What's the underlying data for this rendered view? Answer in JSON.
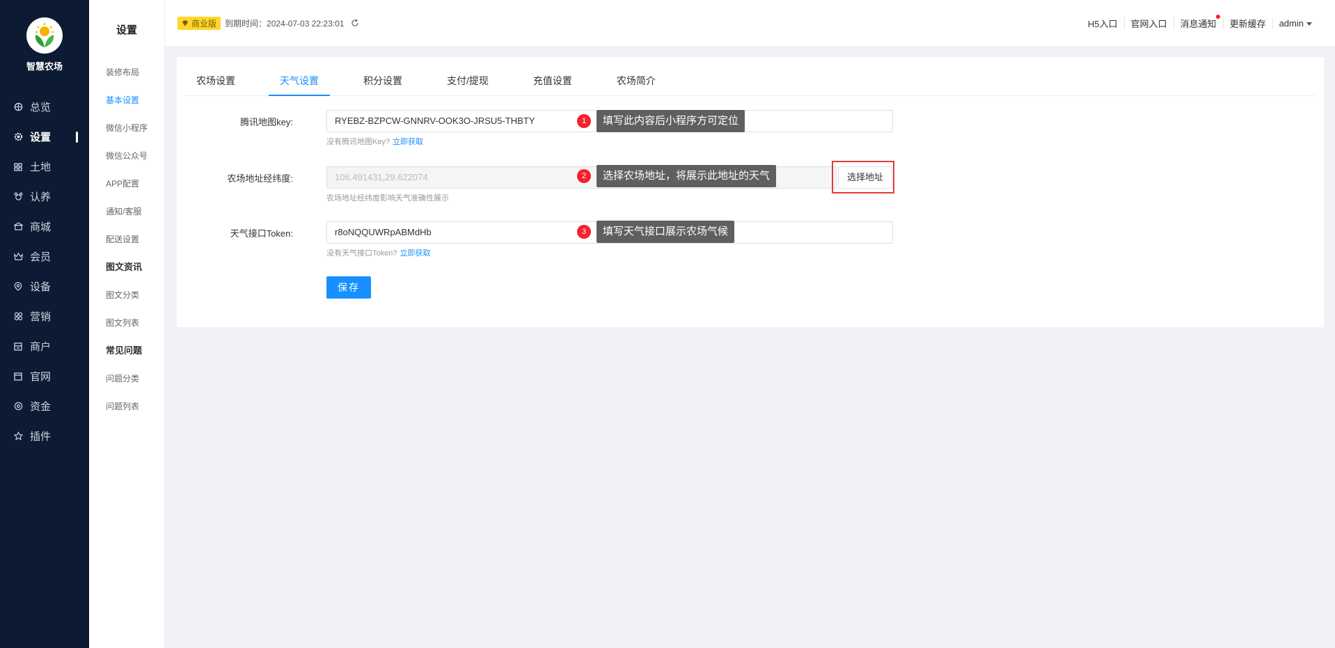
{
  "brand": {
    "name": "智慧农场"
  },
  "nav": [
    {
      "label": "总览",
      "icon": "dashboard-icon"
    },
    {
      "label": "设置",
      "icon": "gear-icon",
      "active": true
    },
    {
      "label": "土地",
      "icon": "grid-icon"
    },
    {
      "label": "认养",
      "icon": "adopt-icon"
    },
    {
      "label": "商城",
      "icon": "shop-icon"
    },
    {
      "label": "会员",
      "icon": "member-icon"
    },
    {
      "label": "设备",
      "icon": "device-icon"
    },
    {
      "label": "营销",
      "icon": "marketing-icon"
    },
    {
      "label": "商户",
      "icon": "merchant-icon"
    },
    {
      "label": "官网",
      "icon": "website-icon"
    },
    {
      "label": "资金",
      "icon": "fund-icon"
    },
    {
      "label": "插件",
      "icon": "star-icon"
    }
  ],
  "subnav": {
    "title": "设置",
    "items": [
      {
        "label": "装修布局"
      },
      {
        "label": "基本设置",
        "active": true
      },
      {
        "label": "微信小程序"
      },
      {
        "label": "微信公众号"
      },
      {
        "label": "APP配置"
      },
      {
        "label": "通知/客服"
      },
      {
        "label": "配送设置"
      }
    ],
    "groups": [
      {
        "title": "图文资讯",
        "items": [
          {
            "label": "图文分类"
          },
          {
            "label": "图文列表"
          }
        ]
      },
      {
        "title": "常见问题",
        "items": [
          {
            "label": "问题分类"
          },
          {
            "label": "问题列表"
          }
        ]
      }
    ]
  },
  "header": {
    "edition": "商业版",
    "expire": "到期时间：2024-07-03 22:23:01",
    "links": [
      "H5入口",
      "官网入口",
      "消息通知",
      "更新缓存"
    ],
    "user": "admin"
  },
  "tabs": [
    "农场设置",
    "天气设置",
    "积分设置",
    "支付/提现",
    "充值设置",
    "农场简介"
  ],
  "form": {
    "map_key_label": "腾讯地图key:",
    "map_key_value": "RYEBZ-BZPCW-GNNRV-OOK3O-JRSU5-THBTY",
    "map_key_hint": "没有腾讯地图Key?",
    "map_key_link": "立即获取",
    "coords_label": "农场地址经纬度:",
    "coords_value": "106.491431,29.622074",
    "coords_hint": "农场地址经纬度影响天气准确性展示",
    "select_address": "选择地址",
    "token_label": "天气接口Token:",
    "token_value": "r8oNQQUWRpABMdHb",
    "token_hint": "没有天气接口Token?",
    "token_link": "立即获取",
    "save": "保存"
  },
  "callouts": [
    {
      "num": "1",
      "text": "填写此内容后小程序方可定位"
    },
    {
      "num": "2",
      "text": "选择农场地址，将展示此地址的天气"
    },
    {
      "num": "3",
      "text": "填写天气接口展示农场气候"
    }
  ],
  "colors": {
    "sidebar": "#0c1a33",
    "primary": "#1890ff",
    "badge": "#ffd62e",
    "alert": "#f5222d"
  }
}
